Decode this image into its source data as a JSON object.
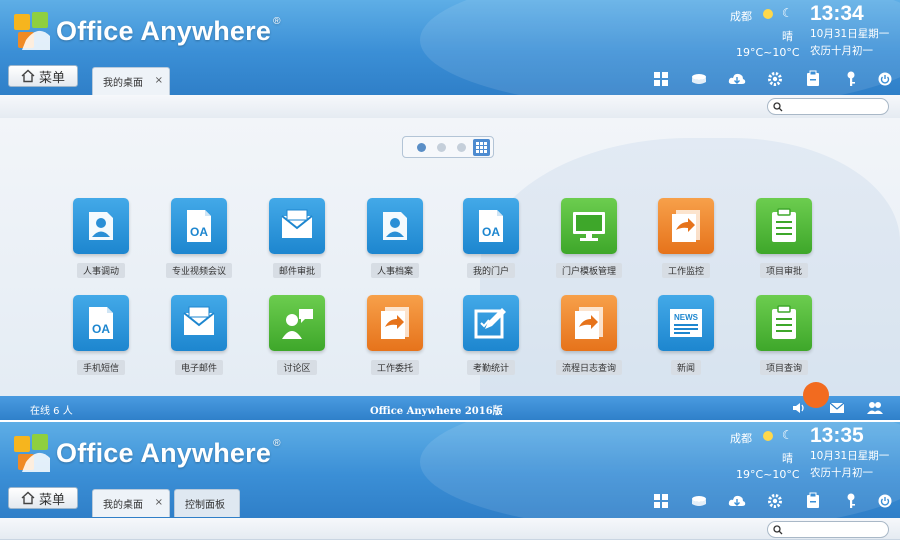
{
  "app": {
    "logo_text": "Office Anywhere",
    "registered_mark": "®"
  },
  "weather": {
    "city": "成都",
    "condition": "晴",
    "temperature": "19°C~10°C"
  },
  "screens": [
    {
      "time": "13:34",
      "date": "10月31日星期一",
      "lunar": "农历十月初一",
      "tabs": [
        {
          "label": "我的桌面",
          "close": "×"
        }
      ]
    },
    {
      "time": "13:35",
      "date": "10月31日星期一",
      "lunar": "农历十月初一",
      "tabs": [
        {
          "label": "我的桌面",
          "close": "×"
        },
        {
          "label": "控制面板",
          "close": ""
        }
      ]
    }
  ],
  "menu": {
    "label": "菜单"
  },
  "search": {
    "placeholder": ""
  },
  "toolbar_icons": [
    "grid-icon",
    "disk-icon",
    "cloud-icon",
    "gear-icon",
    "card-icon",
    "key-icon",
    "power-icon"
  ],
  "apps": [
    {
      "label": "人事调动",
      "icon": "person-doc-icon",
      "color": "blue"
    },
    {
      "label": "专业视频会议",
      "icon": "oa-doc-icon",
      "color": "blue"
    },
    {
      "label": "邮件审批",
      "icon": "mail-icon",
      "color": "blue"
    },
    {
      "label": "人事档案",
      "icon": "person-doc-icon",
      "color": "blue"
    },
    {
      "label": "我的门户",
      "icon": "oa-doc-icon",
      "color": "blue"
    },
    {
      "label": "门户模板管理",
      "icon": "monitor-icon",
      "color": "green"
    },
    {
      "label": "工作监控",
      "icon": "forward-doc-icon",
      "color": "orange"
    },
    {
      "label": "项目审批",
      "icon": "clipboard-icon",
      "color": "green"
    },
    {
      "label": "手机短信",
      "icon": "oa-doc-icon",
      "color": "blue"
    },
    {
      "label": "电子邮件",
      "icon": "mail-icon",
      "color": "blue"
    },
    {
      "label": "讨论区",
      "icon": "chat-icon",
      "color": "green"
    },
    {
      "label": "工作委托",
      "icon": "forward-doc-icon",
      "color": "orange"
    },
    {
      "label": "考勤统计",
      "icon": "edit-icon",
      "color": "blue"
    },
    {
      "label": "流程日志查询",
      "icon": "forward-doc-icon",
      "color": "orange"
    },
    {
      "label": "新闻",
      "icon": "news-icon",
      "color": "blue"
    },
    {
      "label": "项目查询",
      "icon": "clipboard-icon",
      "color": "green"
    }
  ],
  "status": {
    "online": "在线  6  人",
    "version": "Office Anywhere 2016版"
  },
  "colors": {
    "header_blue": "#3b8fd6",
    "app_blue": "#1d86cf",
    "app_green": "#3ea72a",
    "app_orange": "#e6731b"
  }
}
